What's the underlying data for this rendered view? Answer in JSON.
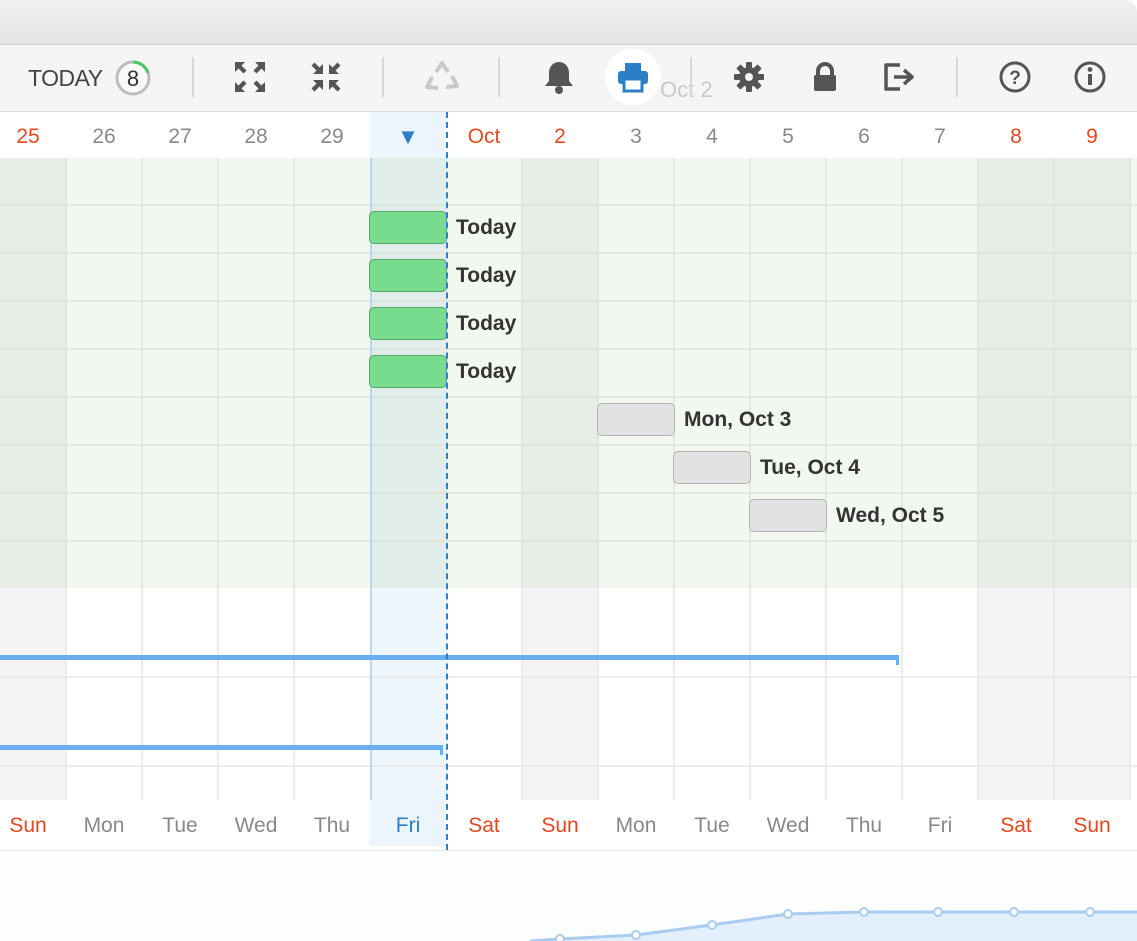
{
  "toolbar": {
    "today_label": "TODAY",
    "today_count": "8",
    "ghost_date": "Oct 2",
    "icons": [
      "expand-icon",
      "collapse-icon",
      "recycle-icon",
      "bell-icon",
      "print-icon",
      "gear-icon",
      "lock-icon",
      "logout-icon",
      "help-icon",
      "info-icon"
    ]
  },
  "date_header": [
    "25",
    "26",
    "27",
    "28",
    "29",
    "▼",
    "Oct",
    "2",
    "3",
    "4",
    "5",
    "6",
    "7",
    "8",
    "9"
  ],
  "weekday_footer": [
    "Sun",
    "Mon",
    "Tue",
    "Wed",
    "Thu",
    "Fri",
    "Sat",
    "Sun",
    "Mon",
    "Tue",
    "Wed",
    "Thu",
    "Fri",
    "Sat",
    "Sun"
  ],
  "tasks": [
    {
      "label": "Today",
      "status": "today"
    },
    {
      "label": "Today",
      "status": "today"
    },
    {
      "label": "Today",
      "status": "today"
    },
    {
      "label": "Today",
      "status": "today"
    },
    {
      "label": "Mon, Oct 3",
      "status": "upcoming"
    },
    {
      "label": "Tue, Oct 4",
      "status": "upcoming"
    },
    {
      "label": "Wed, Oct 5",
      "status": "upcoming"
    }
  ],
  "colors": {
    "weekend": "#e8461f",
    "today_accent": "#2a7fc6",
    "task_today": "#77dc8d",
    "task_upcoming": "#e2e2e2",
    "bar_line": "#6aaef0"
  }
}
